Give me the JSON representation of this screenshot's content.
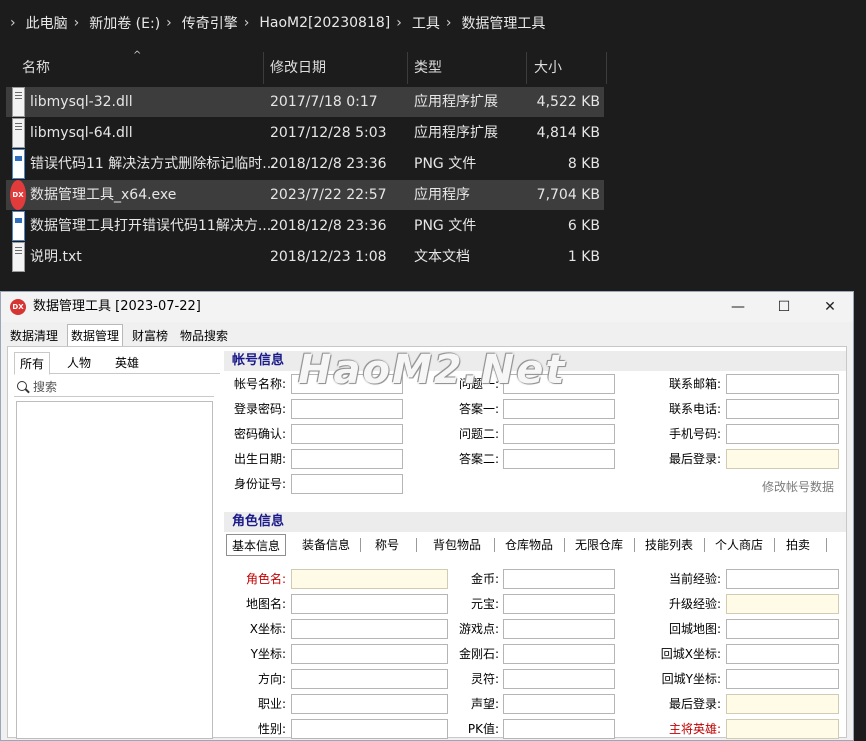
{
  "explorer": {
    "breadcrumb": [
      "此电脑",
      "新加卷 (E:)",
      "传奇引擎",
      "HaoM2[20230818]",
      "工具",
      "数据管理工具"
    ],
    "columns": {
      "name": "名称",
      "date": "修改日期",
      "type": "类型",
      "size": "大小"
    },
    "files": [
      {
        "name": "libmysql-32.dll",
        "date": "2017/7/18 0:17",
        "type": "应用程序扩展",
        "size": "4,522 KB",
        "icon": "dll-file-icon",
        "selected": true
      },
      {
        "name": "libmysql-64.dll",
        "date": "2017/12/28 5:03",
        "type": "应用程序扩展",
        "size": "4,814 KB",
        "icon": "dll-file-icon",
        "selected": false
      },
      {
        "name": "错误代码11 解决法方式删除标记临时...",
        "date": "2018/12/8 23:36",
        "type": "PNG 文件",
        "size": "8 KB",
        "icon": "png-file-icon",
        "selected": false
      },
      {
        "name": "数据管理工具_x64.exe",
        "date": "2023/7/22 22:57",
        "type": "应用程序",
        "size": "7,704 KB",
        "icon": "exe-app-icon",
        "selected": true
      },
      {
        "name": "数据管理工具打开错误代码11解决方...",
        "date": "2018/12/8 23:36",
        "type": "PNG 文件",
        "size": "6 KB",
        "icon": "png-file-icon",
        "selected": false
      },
      {
        "name": "说明.txt",
        "date": "2018/12/23 1:08",
        "type": "文本文档",
        "size": "1 KB",
        "icon": "txt-file-icon",
        "selected": false
      }
    ]
  },
  "window": {
    "title": "数据管理工具 [2023-07-22]",
    "icon_text": "DX",
    "controls": {
      "minimize": "—",
      "maximize": "☐",
      "close": "✕"
    }
  },
  "main_tabs": [
    "数据清理",
    "数据管理",
    "财富榜",
    "物品搜索"
  ],
  "active_main_tab": 1,
  "left_tabs": [
    "所有",
    "人物",
    "英雄"
  ],
  "search": {
    "placeholder": "搜索"
  },
  "watermark": "HaoM2.Net",
  "account": {
    "title": "帐号信息",
    "fields": {
      "account_name": "帐号名称:",
      "login_password": "登录密码:",
      "password_confirm": "密码确认:",
      "birth_date": "出生日期:",
      "id_number": "身份证号:",
      "question1": "问题一:",
      "answer1": "答案一:",
      "question2": "问题二:",
      "answer2": "答案二:",
      "email": "联系邮箱:",
      "phone": "联系电话:",
      "mobile": "手机号码:",
      "last_login": "最后登录:"
    },
    "modify_button": "修改帐号数据"
  },
  "role": {
    "title": "角色信息",
    "tabs": [
      "基本信息",
      "装备信息",
      "称号",
      "背包物品",
      "仓库物品",
      "无限仓库",
      "技能列表",
      "个人商店",
      "拍卖"
    ],
    "active_tab": 0,
    "fields": {
      "role_name": "角色名:",
      "map_name": "地图名:",
      "x_coord": "X坐标:",
      "y_coord": "Y坐标:",
      "direction": "方向:",
      "job": "职业:",
      "gender": "性别:",
      "gold": "金币:",
      "yuanbao": "元宝:",
      "game_points": "游戏点:",
      "diamond": "金刚石:",
      "talisman": "灵符:",
      "prestige": "声望:",
      "pk_value": "PK值:",
      "current_exp": "当前经验:",
      "upgrade_exp": "升级经验:",
      "home_map": "回城地图:",
      "home_x": "回城X坐标:",
      "home_y": "回城Y坐标:",
      "last_login": "最后登录:",
      "main_hero": "主将英雄:"
    }
  }
}
